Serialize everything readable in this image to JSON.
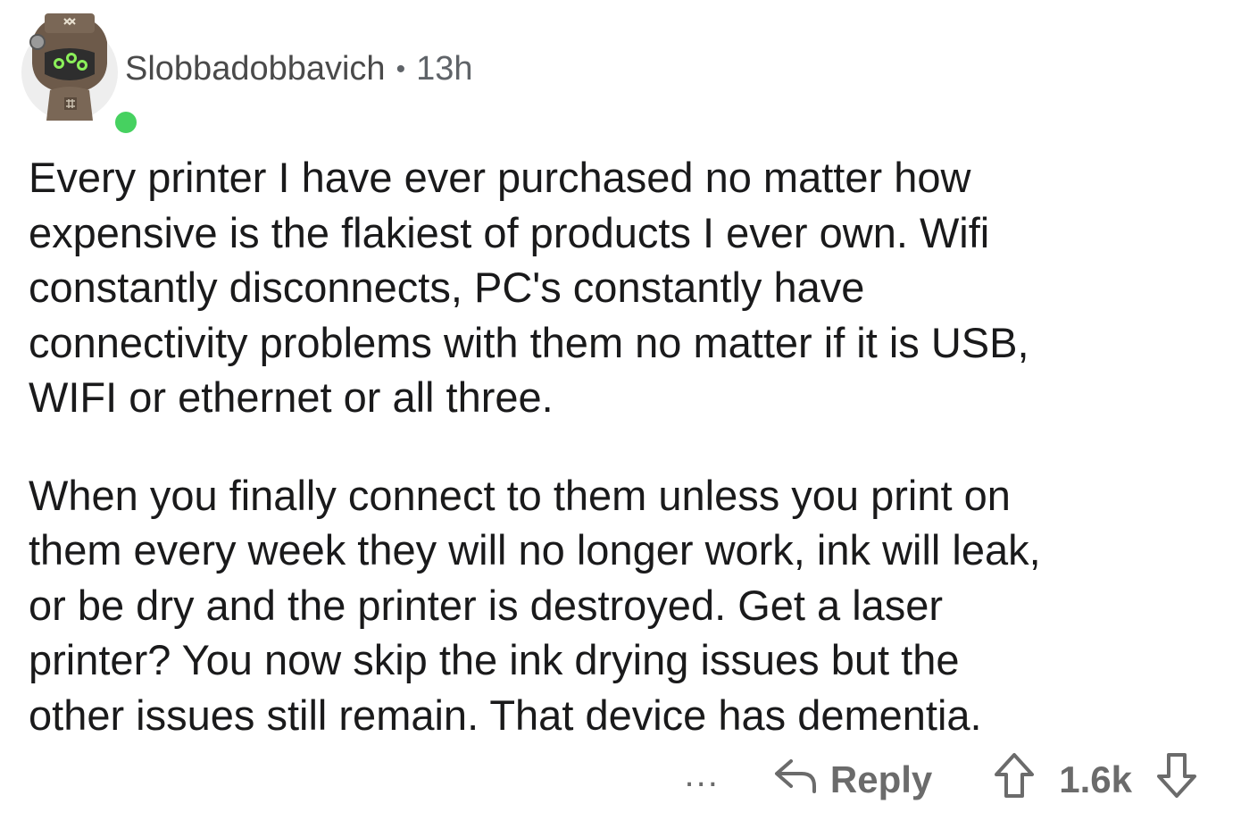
{
  "comment": {
    "author": "Slobbadobbavich",
    "separator": "•",
    "time_ago": "13h",
    "paragraphs": [
      "Every printer I have ever purchased no matter how\nexpensive is the flakiest of products I ever own.  Wifi\nconstantly disconnects, PC's constantly have\nconnectivity problems with them no matter if it is USB,\nWIFI or ethernet or all three.",
      "When you finally connect to them unless you print on\nthem every week they will no longer work, ink will leak,\nor be dry and the printer is destroyed.  Get a laser\nprinter?  You now skip the ink drying issues but the\nother issues still remain.   That device has dementia."
    ],
    "online_status_color": "#46d160"
  },
  "actions": {
    "more_label": "...",
    "reply_label": "Reply",
    "score": "1.6k"
  },
  "icons": {
    "reply": "reply-arrow-icon",
    "upvote": "upvote-arrow-icon",
    "downvote": "downvote-arrow-icon"
  }
}
